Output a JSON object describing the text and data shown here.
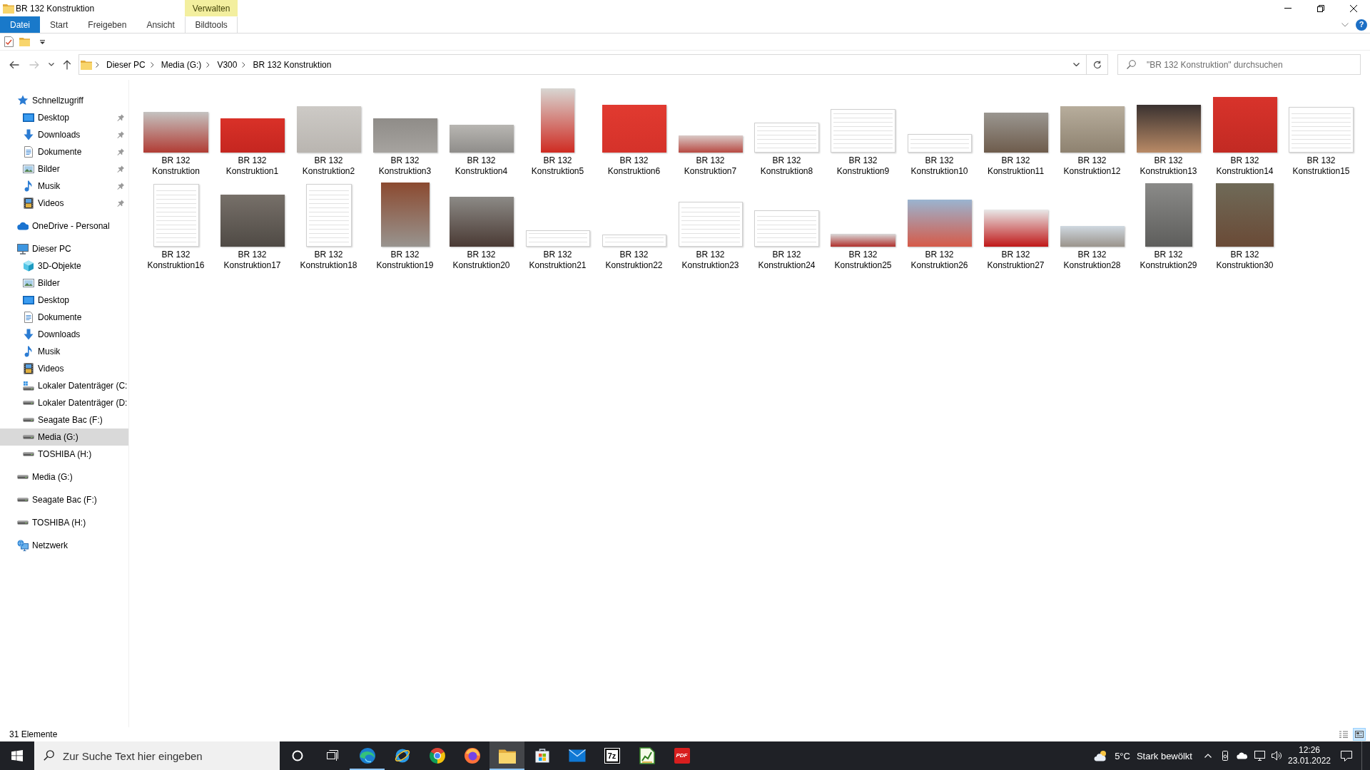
{
  "window": {
    "title": "BR 132 Konstruktion"
  },
  "ribbon": {
    "context_group": "Verwalten",
    "tabs": [
      {
        "label": "Datei",
        "kind": "file",
        "selected": false
      },
      {
        "label": "Start",
        "kind": "tab",
        "selected": false
      },
      {
        "label": "Freigeben",
        "kind": "tab",
        "selected": false
      },
      {
        "label": "Ansicht",
        "kind": "tab",
        "selected": false
      },
      {
        "label": "Bildtools",
        "kind": "context",
        "selected": false
      }
    ],
    "help": "?"
  },
  "navigation": [
    {
      "kind": "back",
      "disabled": false
    },
    {
      "kind": "forward",
      "disabled": true
    },
    {
      "kind": "recent",
      "disabled": false
    },
    {
      "kind": "up",
      "disabled": false
    }
  ],
  "address_bar": {
    "path": [
      "Dieser PC",
      "Media (G:)",
      "V300",
      "BR 132 Konstruktion"
    ]
  },
  "search": {
    "placeholder": "\"BR 132 Konstruktion\" durchsuchen"
  },
  "sidebar": {
    "items": [
      {
        "label": "Schnellzugriff",
        "kind": "quick-access",
        "selected": false,
        "children": [
          {
            "label": "Desktop",
            "kind": "desktop",
            "selected": false,
            "pinned": true
          },
          {
            "label": "Downloads",
            "kind": "downloads",
            "selected": false,
            "pinned": true
          },
          {
            "label": "Dokumente",
            "kind": "documents",
            "selected": false,
            "pinned": true
          },
          {
            "label": "Bilder",
            "kind": "pictures",
            "selected": false,
            "pinned": true
          },
          {
            "label": "Musik",
            "kind": "music",
            "selected": false,
            "pinned": true
          },
          {
            "label": "Videos",
            "kind": "videos",
            "selected": false,
            "pinned": true
          }
        ]
      },
      {
        "label": "OneDrive - Personal",
        "kind": "cloud",
        "selected": false
      },
      {
        "label": "Dieser PC",
        "kind": "computer",
        "selected": false,
        "children": [
          {
            "label": "3D-Objekte",
            "kind": "objects-3d",
            "selected": false
          },
          {
            "label": "Bilder",
            "kind": "pictures",
            "selected": false
          },
          {
            "label": "Desktop",
            "kind": "desktop",
            "selected": false
          },
          {
            "label": "Dokumente",
            "kind": "documents",
            "selected": false
          },
          {
            "label": "Downloads",
            "kind": "downloads",
            "selected": false
          },
          {
            "label": "Musik",
            "kind": "music",
            "selected": false
          },
          {
            "label": "Videos",
            "kind": "videos",
            "selected": false
          },
          {
            "label": "Lokaler Datenträger (C:",
            "kind": "system-drive",
            "selected": false
          },
          {
            "label": "Lokaler Datenträger (D:",
            "kind": "drive",
            "selected": false
          },
          {
            "label": "Seagate Bac (F:)",
            "kind": "drive",
            "selected": false
          },
          {
            "label": "Media (G:)",
            "kind": "drive",
            "selected": true
          },
          {
            "label": "TOSHIBA (H:)",
            "kind": "drive",
            "selected": false
          }
        ]
      },
      {
        "label": "Media (G:)",
        "kind": "drive",
        "selected": false
      },
      {
        "label": "Seagate Bac (F:)",
        "kind": "drive",
        "selected": false
      },
      {
        "label": "TOSHIBA (H:)",
        "kind": "drive",
        "selected": false
      },
      {
        "label": "Netzwerk",
        "kind": "network",
        "selected": false
      }
    ]
  },
  "files": [
    {
      "name": "BR 132 Konstruktion",
      "kind": "photo"
    },
    {
      "name": "BR 132 Konstruktion1",
      "kind": "photo"
    },
    {
      "name": "BR 132 Konstruktion2",
      "kind": "photo"
    },
    {
      "name": "BR 132 Konstruktion3",
      "kind": "photo"
    },
    {
      "name": "BR 132 Konstruktion4",
      "kind": "photo"
    },
    {
      "name": "BR 132 Konstruktion5",
      "kind": "photo"
    },
    {
      "name": "BR 132 Konstruktion6",
      "kind": "photo"
    },
    {
      "name": "BR 132 Konstruktion7",
      "kind": "photo"
    },
    {
      "name": "BR 132 Konstruktion8",
      "kind": "drawing"
    },
    {
      "name": "BR 132 Konstruktion9",
      "kind": "drawing"
    },
    {
      "name": "BR 132 Konstruktion10",
      "kind": "drawing"
    },
    {
      "name": "BR 132 Konstruktion11",
      "kind": "photo"
    },
    {
      "name": "BR 132 Konstruktion12",
      "kind": "photo"
    },
    {
      "name": "BR 132 Konstruktion13",
      "kind": "photo"
    },
    {
      "name": "BR 132 Konstruktion14",
      "kind": "photo"
    },
    {
      "name": "BR 132 Konstruktion15",
      "kind": "drawing"
    },
    {
      "name": "BR 132 Konstruktion16",
      "kind": "drawing"
    },
    {
      "name": "BR 132 Konstruktion17",
      "kind": "photo"
    },
    {
      "name": "BR 132 Konstruktion18",
      "kind": "drawing"
    },
    {
      "name": "BR 132 Konstruktion19",
      "kind": "photo"
    },
    {
      "name": "BR 132 Konstruktion20",
      "kind": "photo"
    },
    {
      "name": "BR 132 Konstruktion21",
      "kind": "drawing"
    },
    {
      "name": "BR 132 Konstruktion22",
      "kind": "drawing"
    },
    {
      "name": "BR 132 Konstruktion23",
      "kind": "drawing"
    },
    {
      "name": "BR 132 Konstruktion24",
      "kind": "drawing"
    },
    {
      "name": "BR 132 Konstruktion25",
      "kind": "photo"
    },
    {
      "name": "BR 132 Konstruktion26",
      "kind": "photo"
    },
    {
      "name": "BR 132 Konstruktion27",
      "kind": "photo"
    },
    {
      "name": "BR 132 Konstruktion28",
      "kind": "photo"
    },
    {
      "name": "BR 132 Konstruktion29",
      "kind": "photo"
    },
    {
      "name": "BR 132 Konstruktion30",
      "kind": "photo"
    }
  ],
  "status_bar": {
    "count": "31 Elemente",
    "views": [
      {
        "kind": "details",
        "selected": false
      },
      {
        "kind": "thumbnails",
        "selected": true
      }
    ]
  },
  "taskbar": {
    "search_placeholder": "Zur Suche Text hier eingeben",
    "apps": [
      {
        "kind": "edge",
        "running": true,
        "selected": false
      },
      {
        "kind": "ie",
        "running": false,
        "selected": false
      },
      {
        "kind": "chrome",
        "running": false,
        "selected": false
      },
      {
        "kind": "firefox",
        "running": false,
        "selected": false
      },
      {
        "kind": "explorer",
        "running": true,
        "selected": true
      },
      {
        "kind": "store",
        "running": false,
        "selected": false
      },
      {
        "kind": "mail",
        "running": false,
        "selected": false
      },
      {
        "kind": "archive",
        "label": "7z",
        "running": false,
        "selected": false
      },
      {
        "kind": "spreadsheet",
        "running": false,
        "selected": false
      },
      {
        "kind": "pdf",
        "label": "PDF",
        "running": false,
        "selected": false
      }
    ],
    "weather": {
      "temperature": "5°C",
      "condition": "Stark bewölkt"
    },
    "clock": {
      "time": "12:26",
      "date": "23.01.2022"
    }
  }
}
